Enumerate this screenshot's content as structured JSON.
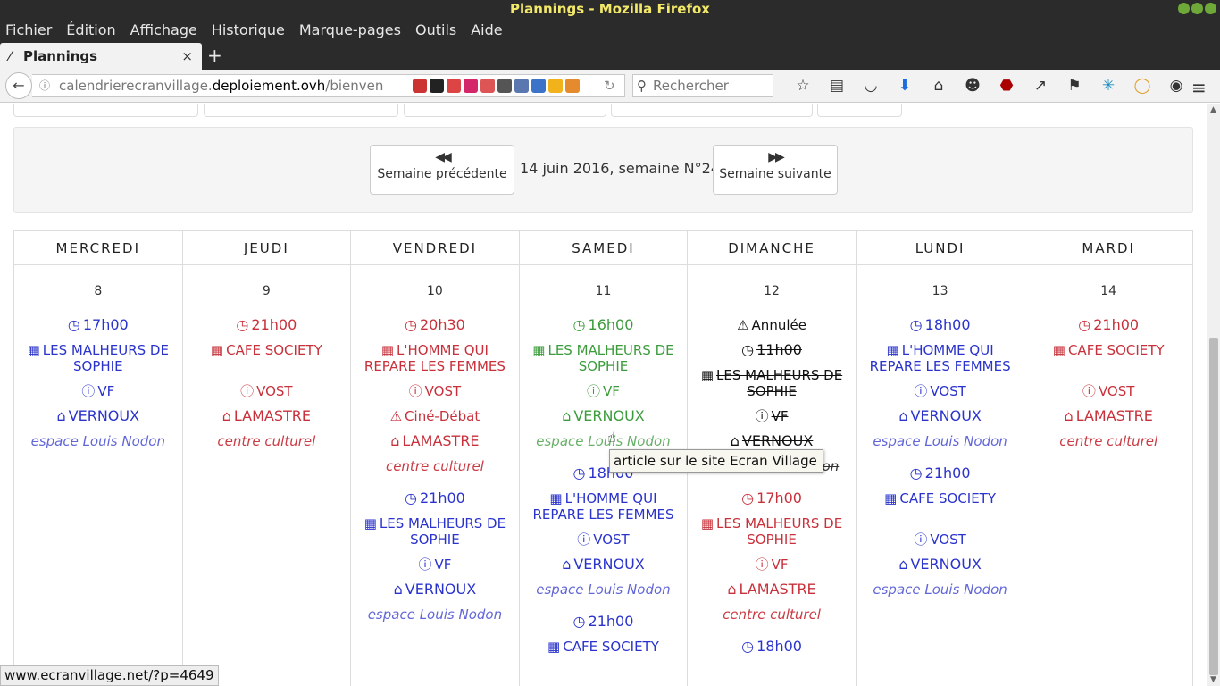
{
  "window": {
    "title": "Plannings - Mozilla Firefox"
  },
  "menu": [
    "Fichier",
    "Édition",
    "Affichage",
    "Historique",
    "Marque-pages",
    "Outils",
    "Aide"
  ],
  "tab": {
    "label": "Plannings",
    "close": "×",
    "new": "+"
  },
  "address": {
    "url_pre": "calendrierecranvillage.",
    "url_domain": "deploiement.ovh",
    "url_post": "/bienven"
  },
  "search": {
    "placeholder": "Rechercher"
  },
  "week": {
    "prev_label": "Semaine précédente",
    "next_label": "Semaine suivante",
    "current": "14 juin 2016, semaine N°24"
  },
  "days": [
    {
      "name": "MERCREDI",
      "num": "8",
      "events": [
        {
          "color": "blue",
          "time": "17h00",
          "film": "LES MALHEURS DE SOPHIE",
          "version": "VF",
          "place": "VERNOUX",
          "venue": "espace Louis Nodon"
        }
      ]
    },
    {
      "name": "JEUDI",
      "num": "9",
      "events": [
        {
          "color": "red",
          "time": "21h00",
          "film": "CAFE SOCIETY",
          "version": "VOST",
          "place": "LAMASTRE",
          "venue": "centre culturel"
        }
      ]
    },
    {
      "name": "VENDREDI",
      "num": "10",
      "events": [
        {
          "color": "red",
          "time": "20h30",
          "film": "L'HOMME QUI REPARE LES FEMMES",
          "version": "VOST",
          "note": "Ciné-Débat",
          "place": "LAMASTRE",
          "venue": "centre culturel"
        },
        {
          "color": "blue",
          "time": "21h00",
          "film": "LES MALHEURS DE SOPHIE",
          "version": "VF",
          "place": "VERNOUX",
          "venue": "espace Louis Nodon"
        }
      ]
    },
    {
      "name": "SAMEDI",
      "num": "11",
      "events": [
        {
          "color": "green",
          "time": "16h00",
          "film": "LES MALHEURS DE SOPHIE",
          "version": "VF",
          "place": "VERNOUX",
          "venue": "espace Louis Nodon"
        },
        {
          "color": "blue",
          "time": "18h00",
          "film": "L'HOMME QUI REPARE LES FEMMES",
          "version": "VOST",
          "place": "VERNOUX",
          "venue": "espace Louis Nodon"
        },
        {
          "color": "blue",
          "time": "21h00",
          "film": "CAFE SOCIETY"
        }
      ]
    },
    {
      "name": "DIMANCHE",
      "num": "12",
      "events": [
        {
          "color": "black",
          "status": "Annulée",
          "cancelled": true,
          "time": "11h00",
          "film": "LES MALHEURS DE SOPHIE",
          "version": "VF",
          "place": "VERNOUX",
          "venue": "espace Louis Nodon"
        },
        {
          "color": "red",
          "time": "17h00",
          "film": "LES MALHEURS DE SOPHIE",
          "version": "VF",
          "place": "LAMASTRE",
          "venue": "centre culturel"
        },
        {
          "color": "blue",
          "time": "18h00"
        }
      ]
    },
    {
      "name": "LUNDI",
      "num": "13",
      "events": [
        {
          "color": "blue",
          "time": "18h00",
          "film": "L'HOMME QUI REPARE LES FEMMES",
          "version": "VOST",
          "place": "VERNOUX",
          "venue": "espace Louis Nodon"
        },
        {
          "color": "blue",
          "time": "21h00",
          "film": "CAFE SOCIETY",
          "version": "VOST",
          "place": "VERNOUX",
          "venue": "espace Louis Nodon"
        }
      ]
    },
    {
      "name": "MARDI",
      "num": "14",
      "events": [
        {
          "color": "red",
          "time": "21h00",
          "film": "CAFE SOCIETY",
          "version": "VOST",
          "place": "LAMASTRE",
          "venue": "centre culturel"
        }
      ]
    }
  ],
  "tooltip": "article sur le site Ecran Village",
  "status_url": "www.ecranvillage.net/?p=4649"
}
